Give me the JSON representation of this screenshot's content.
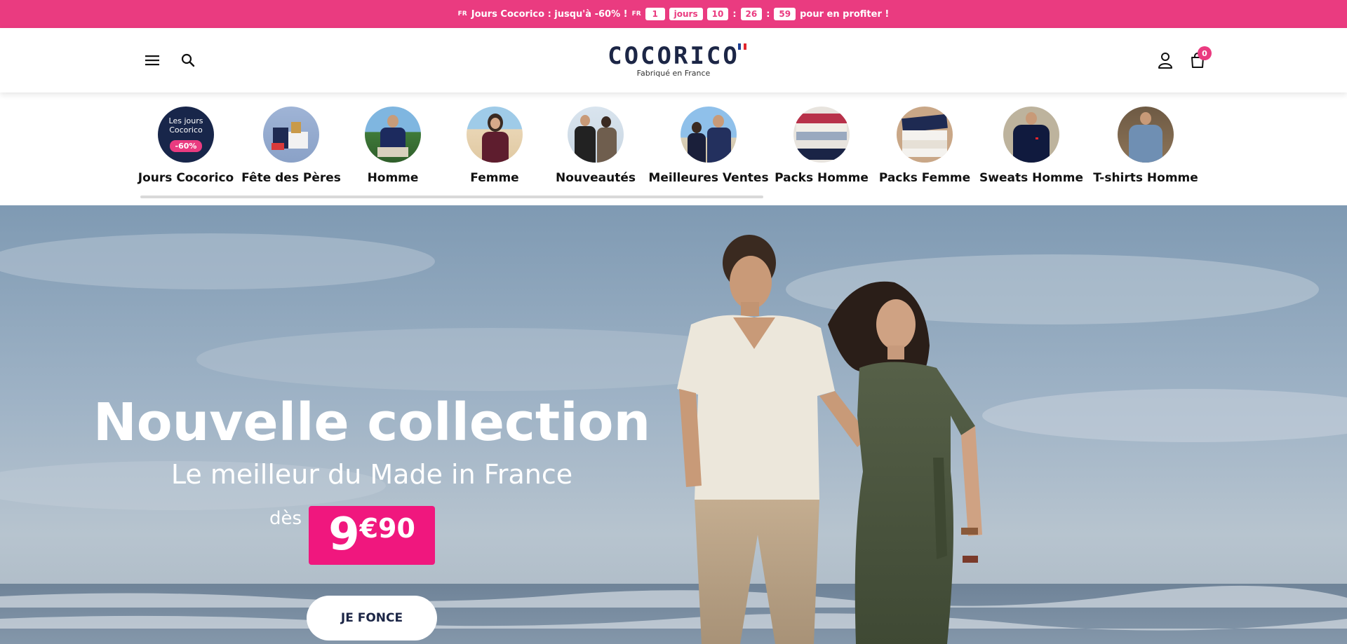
{
  "promo": {
    "flag_left": "FR",
    "text": "Jours Cocorico : jusqu'à -60% !",
    "flag_right": "FR",
    "countdown": {
      "days": "1",
      "days_label": "jours",
      "hours": "10",
      "sep1": ":",
      "minutes": "26",
      "sep2": ":",
      "seconds": "59"
    },
    "suffix": "pour en profiter !"
  },
  "header": {
    "logo": "COCORICO",
    "tagline": "Fabriqué en France",
    "cart_count": "0",
    "icons": [
      "menu-icon",
      "search-icon",
      "user-icon",
      "bag-icon"
    ]
  },
  "categories": [
    {
      "label": "Jours Cocorico",
      "badge_lines": [
        "Les jours",
        "Cocorico"
      ],
      "badge_discount": "-60%"
    },
    {
      "label": "Fête des Pères"
    },
    {
      "label": "Homme"
    },
    {
      "label": "Femme"
    },
    {
      "label": "Nouveautés"
    },
    {
      "label": "Meilleures Ventes"
    },
    {
      "label": "Packs Homme"
    },
    {
      "label": "Packs Femme"
    },
    {
      "label": "Sweats Homme"
    },
    {
      "label": "T-shirts Homme"
    }
  ],
  "hero": {
    "title": "Nouvelle collection",
    "subtitle": "Le meilleur du Made in France",
    "price_prefix": "dès",
    "price_main": "9",
    "price_rest": "€90",
    "cta": "JE FONCE"
  },
  "colors": {
    "accent": "#ea3b80",
    "price_bg": "#f0177e",
    "navy": "#1c2646"
  }
}
